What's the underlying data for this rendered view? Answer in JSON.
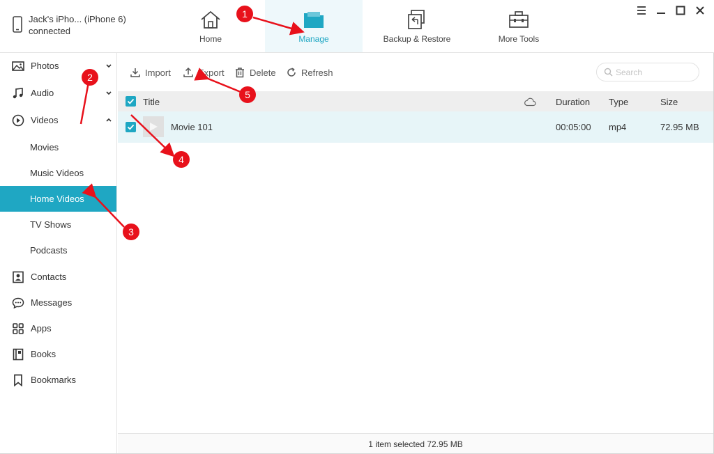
{
  "device": {
    "name": "Jack's iPho... (iPhone 6)",
    "status": "connected"
  },
  "nav": {
    "tabs": [
      {
        "label": "Home",
        "icon": "home-icon"
      },
      {
        "label": "Manage",
        "icon": "folder-icon",
        "active": true
      },
      {
        "label": "Backup & Restore",
        "icon": "backup-restore-icon"
      },
      {
        "label": "More Tools",
        "icon": "toolbox-icon"
      }
    ]
  },
  "sidebar": {
    "items": [
      {
        "label": "Photos",
        "icon": "photo-icon",
        "chevron": "down"
      },
      {
        "label": "Audio",
        "icon": "music-note-icon",
        "chevron": "down"
      },
      {
        "label": "Videos",
        "icon": "play-circle-icon",
        "chevron": "up"
      }
    ],
    "video_subitems": [
      {
        "label": "Movies"
      },
      {
        "label": "Music Videos"
      },
      {
        "label": "Home Videos",
        "active": true
      },
      {
        "label": "TV Shows"
      },
      {
        "label": "Podcasts"
      }
    ],
    "more_items": [
      {
        "label": "Contacts",
        "icon": "contact-icon"
      },
      {
        "label": "Messages",
        "icon": "chat-bubble-icon"
      },
      {
        "label": "Apps",
        "icon": "apps-grid-icon"
      },
      {
        "label": "Books",
        "icon": "book-icon"
      },
      {
        "label": "Bookmarks",
        "icon": "bookmark-icon"
      }
    ]
  },
  "toolbar": {
    "import_label": "Import",
    "export_label": "Export",
    "delete_label": "Delete",
    "refresh_label": "Refresh",
    "search_placeholder": "Search"
  },
  "table": {
    "headers": {
      "title": "Title",
      "duration": "Duration",
      "type": "Type",
      "size": "Size"
    },
    "rows": [
      {
        "title": "Movie 101",
        "duration": "00:05:00",
        "type": "mp4",
        "size": "72.95 MB",
        "checked": true
      }
    ]
  },
  "status_bar": {
    "text": "1 item selected 72.95 MB"
  },
  "annotations": {
    "badges": [
      "1",
      "2",
      "3",
      "4",
      "5"
    ]
  },
  "colors": {
    "accent": "#1fa7c3",
    "annotation_red": "#e8111b",
    "row_selected": "#e7f5f8",
    "header_bg": "#eeeeee"
  }
}
